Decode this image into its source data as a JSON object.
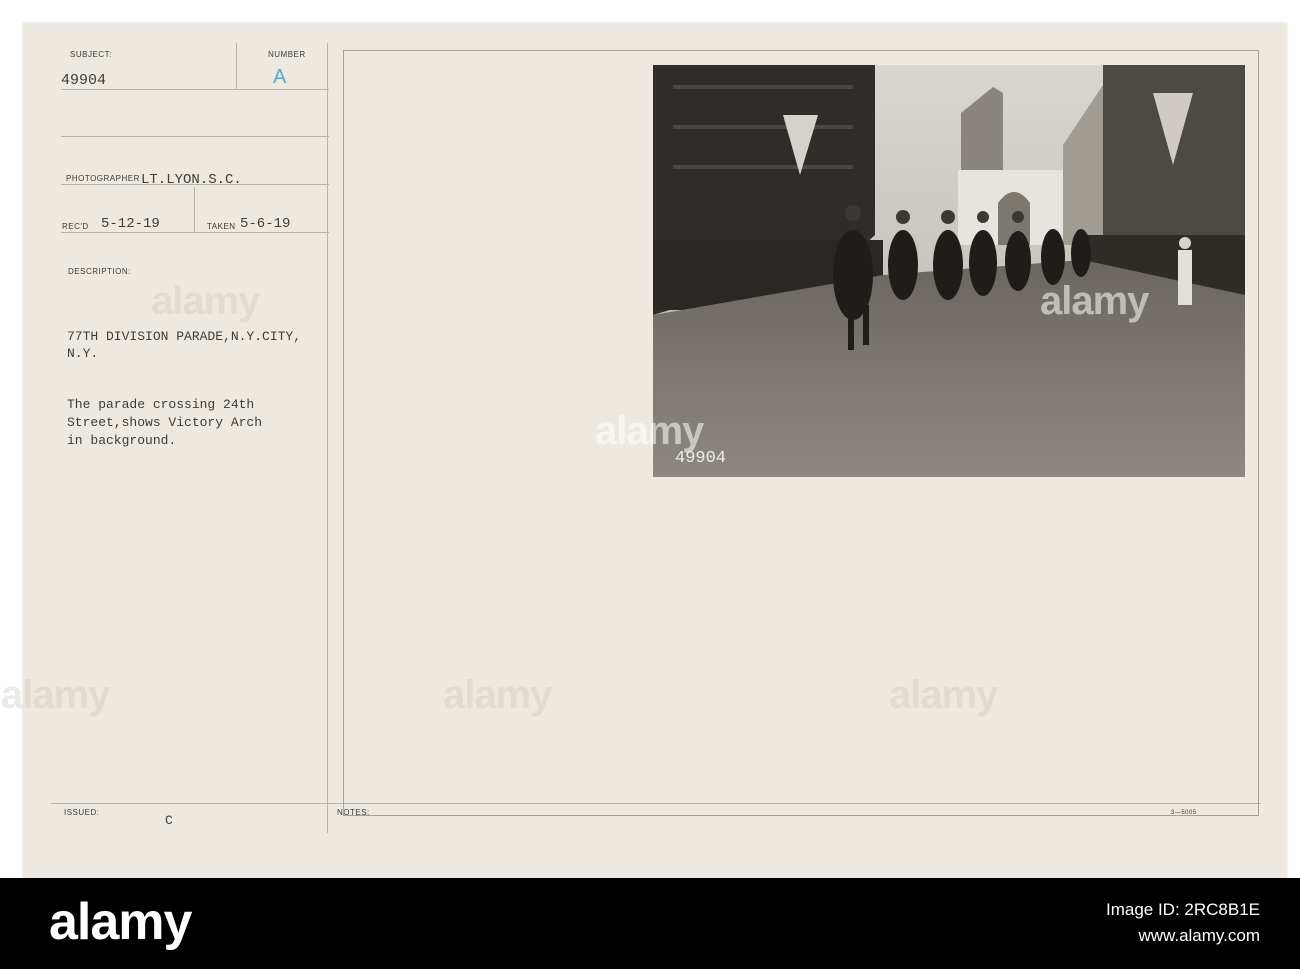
{
  "card": {
    "subject_label": "SUBJECT:",
    "subject_value": "49904",
    "number_label": "NUMBER",
    "number_value": "A",
    "photographer_label": "PHOTOGRAPHER",
    "photographer_value": "LT.LYON.S.C.",
    "recd_label": "REC'D",
    "recd_value": "5-12-19",
    "taken_label": "TAKEN",
    "taken_value": "5-6-19",
    "description_label": "DESCRIPTION:",
    "description_title_1": "77TH DIVISION PARADE,N.Y.CITY,",
    "description_title_2": "N.Y.",
    "description_text_1": "The parade crossing 24th",
    "description_text_2": "Street,shows Victory Arch",
    "description_text_3": "in background.",
    "issued_label": "ISSUED:",
    "issued_value": "C",
    "notes_label": "NOTES:",
    "form_code": "3—5005"
  },
  "photo": {
    "negative_number": "49904"
  },
  "watermark": {
    "text": "alamy"
  },
  "footer": {
    "logo": "alamy",
    "image_id_label": "Image ID: 2RC8B1E",
    "site": "www.alamy.com"
  },
  "colors": {
    "card": "#eee9e0",
    "ink": "#3c3c3c",
    "number_ink": "#5aa7c9",
    "footer": "#000000"
  }
}
